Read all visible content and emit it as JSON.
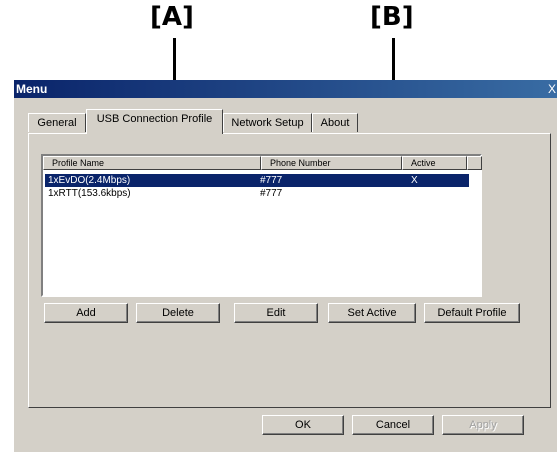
{
  "callouts": {
    "a": "[A]",
    "b": "[B]"
  },
  "window": {
    "title": "Menu",
    "close_glyph": "X"
  },
  "tabs": [
    {
      "label": "General"
    },
    {
      "label": "USB Connection Profile"
    },
    {
      "label": "Network Setup"
    },
    {
      "label": "About"
    }
  ],
  "profile_list": {
    "columns": [
      "Profile Name",
      "Phone Number",
      "Active",
      ""
    ],
    "rows": [
      {
        "name": "1xEvDO(2.4Mbps)",
        "phone": "#777",
        "active": "X"
      },
      {
        "name": "1xRTT(153.6kbps)",
        "phone": "#777",
        "active": ""
      }
    ]
  },
  "actions": {
    "add": "Add",
    "delete": "Delete",
    "edit": "Edit",
    "set_active": "Set Active",
    "default_profile": "Default Profile"
  },
  "footer": {
    "ok": "OK",
    "cancel": "Cancel",
    "apply": "Apply"
  },
  "colors": {
    "selection": "#0a246a",
    "titlebar": "#0a246a",
    "face": "#d4d0c8"
  }
}
